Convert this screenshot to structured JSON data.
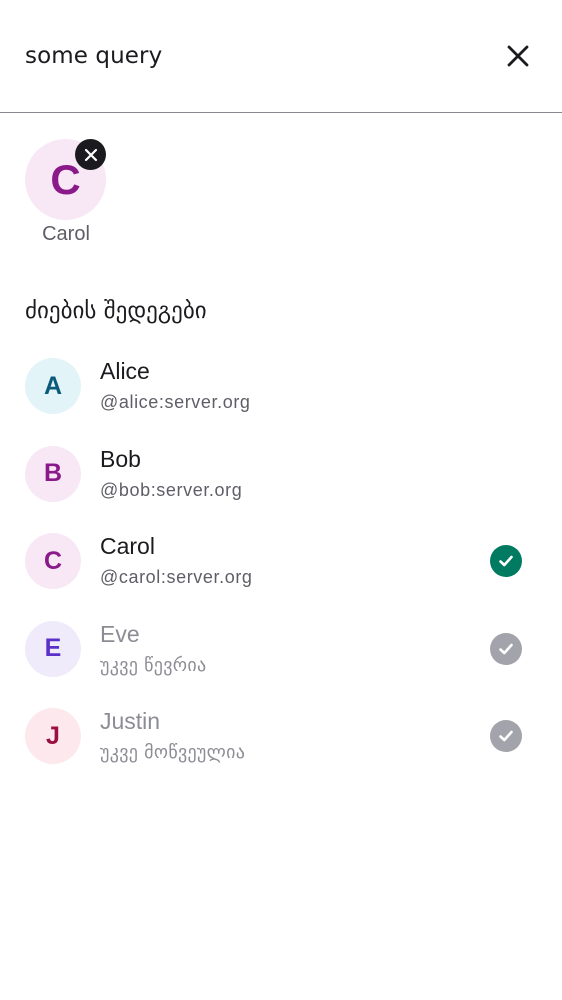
{
  "search": {
    "query": "some query",
    "close_icon": "close-icon"
  },
  "selected": [
    {
      "initial": "C",
      "label": "Carol",
      "avatar_bg": "#f8e8f6",
      "avatar_fg": "#8a1a8a",
      "remove_icon": "close-icon"
    }
  ],
  "results_heading": "ძიების შედეგები",
  "results": [
    {
      "initial": "A",
      "name": "Alice",
      "subtitle": "@alice:server.org",
      "avatar_bg": "#e3f4f9",
      "avatar_fg": "#0a5a7a",
      "state": "none",
      "dimmed": false
    },
    {
      "initial": "B",
      "name": "Bob",
      "subtitle": "@bob:server.org",
      "avatar_bg": "#f8e8f6",
      "avatar_fg": "#8a1a8a",
      "state": "none",
      "dimmed": false
    },
    {
      "initial": "C",
      "name": "Carol",
      "subtitle": "@carol:server.org",
      "avatar_bg": "#f8e8f6",
      "avatar_fg": "#8a1a8a",
      "state": "selected",
      "check_color": "#007a61",
      "dimmed": false
    },
    {
      "initial": "E",
      "name": "Eve",
      "subtitle": "უკვე წევრია",
      "avatar_bg": "#efebfb",
      "avatar_fg": "#5b30c6",
      "state": "disabled",
      "check_color": "#a3a3ab",
      "dimmed": true
    },
    {
      "initial": "J",
      "name": "Justin",
      "subtitle": "უკვე მოწვეულია",
      "avatar_bg": "#fde8ee",
      "avatar_fg": "#9a1040",
      "state": "disabled",
      "check_color": "#a3a3ab",
      "dimmed": true
    }
  ]
}
